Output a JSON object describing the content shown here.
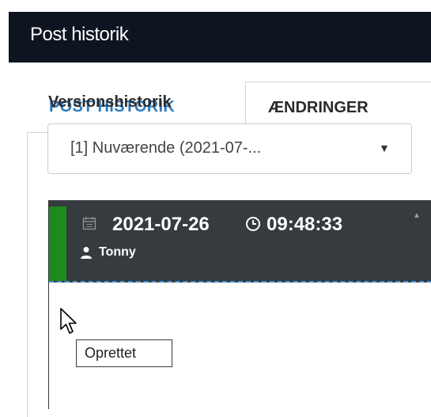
{
  "window": {
    "title": "Post historik"
  },
  "tabs": [
    {
      "label": "POST HISTORIK",
      "active": false
    },
    {
      "label": "ÆNDRINGER",
      "active": true
    }
  ],
  "version_history": {
    "label": "Versionshistorik",
    "selected": "[1] Nuværende (2021-07-..."
  },
  "entries": [
    {
      "date": "2021-07-26",
      "time": "09:48:33",
      "user": "Tonny",
      "status_color": "#1d8a1d"
    }
  ],
  "tooltip": {
    "text": "Oprettet"
  },
  "colors": {
    "titlebar": "#0e1520",
    "tab_accent": "#2e7bbf",
    "entry_background": "#353b3f",
    "status_created": "#1d8a1d"
  },
  "icons": [
    "calendar-icon",
    "clock-icon",
    "user-icon",
    "caret-down-icon",
    "scroll-up-icon",
    "mouse-cursor-icon"
  ]
}
